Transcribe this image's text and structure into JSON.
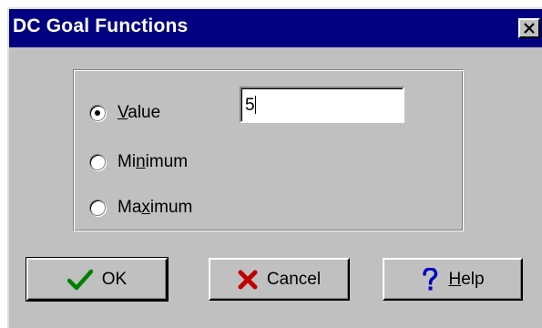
{
  "window": {
    "title": "DC Goal Functions",
    "colors": {
      "titlebar": "#000080",
      "face": "#c0c0c0"
    }
  },
  "options": [
    {
      "id": "value",
      "label_pre": "",
      "mnemonic": "V",
      "label_post": "alue",
      "selected": true
    },
    {
      "id": "minimum",
      "label_pre": "Mi",
      "mnemonic": "n",
      "label_post": "imum",
      "selected": false
    },
    {
      "id": "maximum",
      "label_pre": "Ma",
      "mnemonic": "x",
      "label_post": "imum",
      "selected": false
    }
  ],
  "value_field": {
    "value": "5"
  },
  "buttons": {
    "ok": {
      "label": "OK",
      "icon": "checkmark-icon",
      "icon_color": "#008000"
    },
    "cancel": {
      "label": "Cancel",
      "icon": "x-icon",
      "icon_color": "#c00000"
    },
    "help": {
      "label_mnemonic": "H",
      "label_rest": "elp",
      "icon": "question-icon",
      "icon_color": "#0000c0"
    }
  }
}
